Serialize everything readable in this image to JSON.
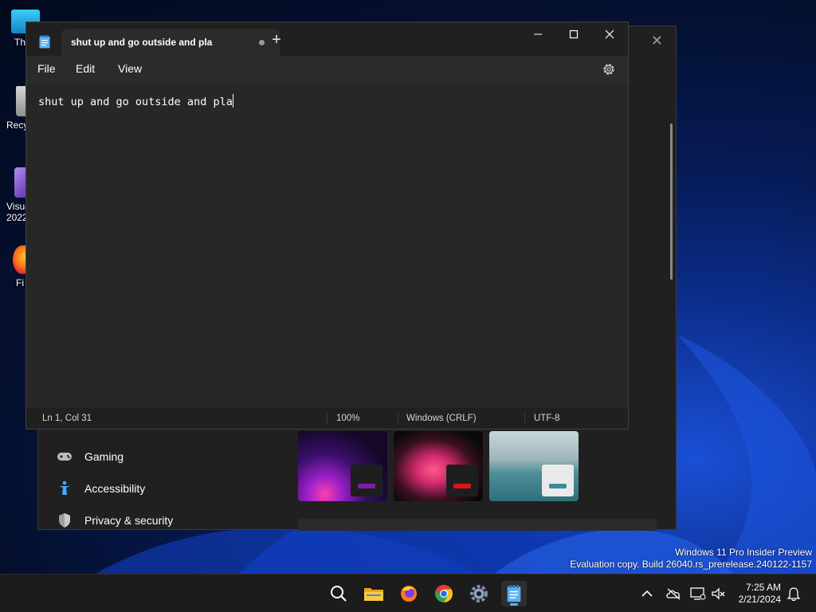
{
  "desktop": {
    "icons": [
      {
        "label": "Th"
      },
      {
        "label": "Recy"
      },
      {
        "label": "Visua 2022"
      },
      {
        "label": "Fi"
      }
    ]
  },
  "settings": {
    "nav": [
      {
        "label": "Gaming",
        "icon": "gamepad-icon"
      },
      {
        "label": "Accessibility",
        "icon": "accessibility-icon"
      },
      {
        "label": "Privacy & security",
        "icon": "shield-icon"
      }
    ],
    "theme_accents": [
      "#7a1fa8",
      "#d9161c",
      "#3a8c9a"
    ]
  },
  "notepad": {
    "tab_title": "shut up and go outside and pla",
    "new_tab": "+",
    "menu": {
      "file": "File",
      "edit": "Edit",
      "view": "View"
    },
    "content": "shut up and go outside and pla",
    "status": {
      "position": "Ln 1, Col 31",
      "zoom": "100%",
      "line_ending": "Windows (CRLF)",
      "encoding": "UTF-8"
    }
  },
  "watermark": {
    "line1": "Windows 11 Pro Insider Preview",
    "line2": "Evaluation copy. Build 26040.rs_prerelease.240122-1157"
  },
  "taskbar": {
    "apps": [
      "search-icon",
      "file-explorer-icon",
      "firefox-icon",
      "chrome-icon",
      "settings-icon",
      "notepad-icon"
    ],
    "time": "7:25 AM",
    "date": "2/21/2024"
  }
}
